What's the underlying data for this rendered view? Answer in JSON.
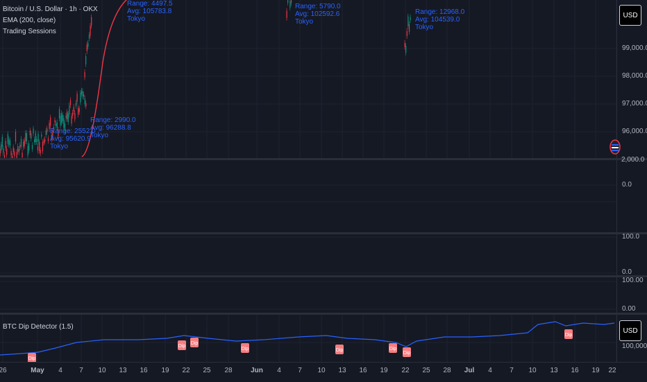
{
  "main_legend": {
    "symbol": "Bitcoin / U.S. Dollar · 1h · OKX",
    "ema": "EMA (200, close)",
    "sessions": "Trading Sessions"
  },
  "currency_button": "USD",
  "main_price_ticks": [
    "99,000.0",
    "98,000.0",
    "97,000.0",
    "96,000.0",
    "2,000.0"
  ],
  "pane2_ticks": [
    "0.0"
  ],
  "pane3_ticks": [
    "100.0",
    "0.0"
  ],
  "pane4_ticks": [
    "100.00",
    "0.00"
  ],
  "dip_detector": {
    "legend": "BTC Dip Detector (1.5)",
    "currency_button": "USD",
    "ticks": [
      "100,000.0"
    ],
    "signal_label": "Dip"
  },
  "session_labels": {
    "a": [
      "Range: 2990.0",
      "Avg: 96288.8",
      "Tokyo"
    ],
    "b": [
      "Range: 2552.0",
      "Avg: 95620.9",
      "Tokyo"
    ],
    "c": [
      "Range: 4497.5",
      "Avg: 105783.8",
      "Tokyo"
    ],
    "d": [
      "Range: 5790.0",
      "Avg: 102592.6",
      "Tokyo"
    ],
    "e": [
      "Range: 12968.0",
      "Avg: 104539.0",
      "Tokyo"
    ]
  },
  "x_axis_labels": [
    "26",
    "May",
    "4",
    "7",
    "10",
    "13",
    "16",
    "19",
    "22",
    "25",
    "28",
    "Jun",
    "4",
    "7",
    "10",
    "13",
    "16",
    "19",
    "22",
    "25",
    "28",
    "Jul",
    "4",
    "7",
    "10",
    "13",
    "16",
    "19",
    "22"
  ],
  "colors": {
    "background": "#151924",
    "grid": "#1f2331",
    "ema": "#f23645",
    "up": "#089981",
    "down": "#f23645",
    "session": "#2962ff",
    "dip_line": "#2962ff",
    "dip_signal": "#f77c80"
  }
}
